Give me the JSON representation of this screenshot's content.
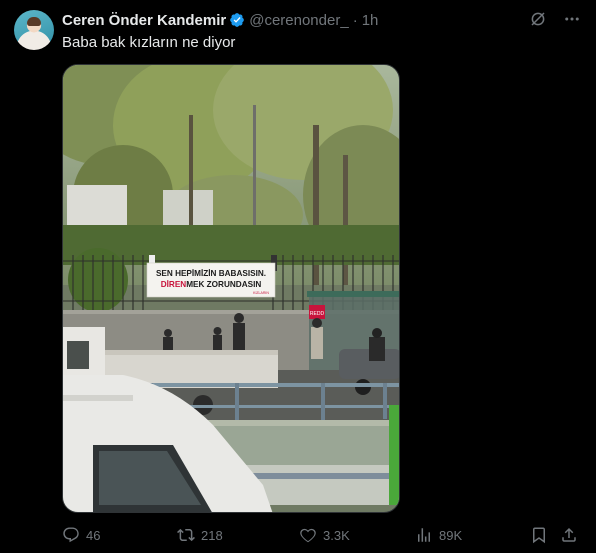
{
  "author": {
    "name": "Ceren Önder Kandemir",
    "handle": "@cerenonder_",
    "separator": "·",
    "time": "1h"
  },
  "tweet": {
    "text": "Baba bak kızların ne diyor"
  },
  "banner": {
    "line1": "SEN HEPİMİZİN BABASISIN.",
    "line2_red": "DİREN",
    "line2_rest": "MEK ZORUNDASIN",
    "signature": "KIZLARIN",
    "sign_text": "REDD"
  },
  "actions": {
    "replies": "46",
    "reposts": "218",
    "likes": "3.3K",
    "views": "89K"
  },
  "colors": {
    "background": "#000000",
    "text_primary": "#e7e9ea",
    "text_secondary": "#71767b",
    "verified_blue": "#1d9bf0",
    "banner_red": "#c8143c"
  },
  "icons": [
    "verified-badge-icon",
    "grok-icon",
    "more-icon",
    "reply-icon",
    "repost-icon",
    "like-icon",
    "views-icon",
    "bookmark-icon",
    "share-icon"
  ]
}
